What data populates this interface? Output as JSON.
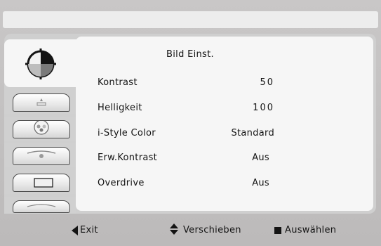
{
  "menu": {
    "title": "Bild Einst.",
    "tabs": [
      {
        "icon": "picture-icon",
        "active": true
      },
      {
        "icon": "position-icon",
        "active": false
      },
      {
        "icon": "color-icon",
        "active": false
      },
      {
        "icon": "size-icon",
        "active": false
      },
      {
        "icon": "settings-icon",
        "active": false
      },
      {
        "icon": "information-icon",
        "active": false
      }
    ],
    "items": [
      {
        "label": "Kontrast",
        "value": "50"
      },
      {
        "label": "Helligkeit",
        "value": "100"
      },
      {
        "label": "i-Style Color",
        "value": "Standard"
      },
      {
        "label": "Erw.Kontrast",
        "value": "Aus"
      },
      {
        "label": "Overdrive",
        "value": "Aus"
      }
    ]
  },
  "footer": {
    "exit_label": "Exit",
    "move_label": "Verschieben",
    "select_label": "Auswählen"
  },
  "colors": {
    "panel": "#f6f6f6",
    "frame": "#cfcfcf",
    "background": "#bcbaba"
  }
}
